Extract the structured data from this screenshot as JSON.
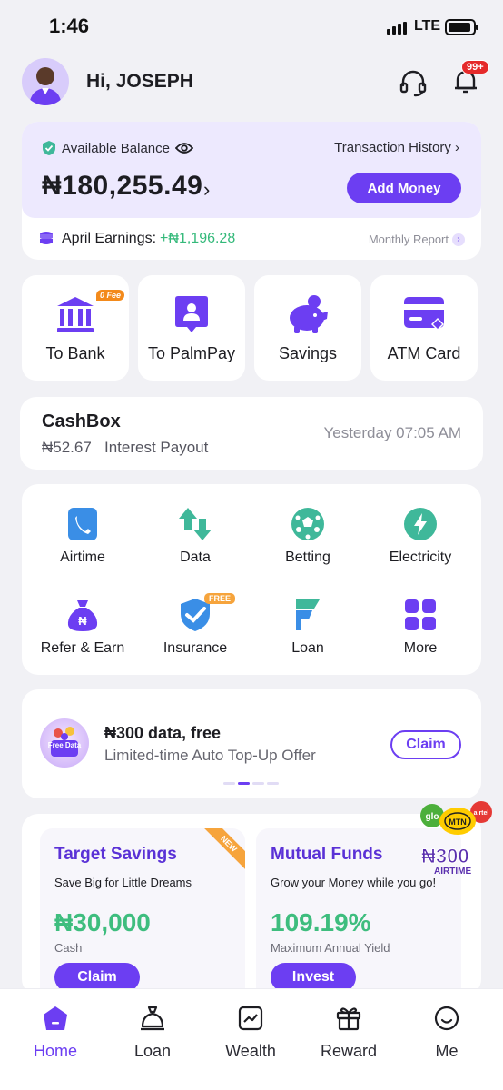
{
  "status": {
    "time": "1:46",
    "network": "LTE"
  },
  "header": {
    "greeting": "Hi, JOSEPH",
    "notif_badge": "99+"
  },
  "balance": {
    "label": "Available Balance",
    "history_link": "Transaction History",
    "amount": "₦180,255.49",
    "add_money": "Add Money",
    "earnings_label": "April Earnings:",
    "earnings_value": "+₦1,196.28",
    "monthly_report": "Monthly Report"
  },
  "quick_actions": [
    {
      "label": "To Bank",
      "icon": "bank-icon",
      "badge": "0 Fee"
    },
    {
      "label": "To PalmPay",
      "icon": "palmpay-icon"
    },
    {
      "label": "Savings",
      "icon": "piggy-bank-icon"
    },
    {
      "label": "ATM Card",
      "icon": "atm-card-icon"
    }
  ],
  "cashbox": {
    "title": "CashBox",
    "amount": "₦52.67",
    "desc": "Interest Payout",
    "time": "Yesterday 07:05 AM"
  },
  "services": [
    {
      "label": "Airtime",
      "icon": "phone-icon"
    },
    {
      "label": "Data",
      "icon": "data-arrows-icon"
    },
    {
      "label": "Betting",
      "icon": "soccer-ball-icon"
    },
    {
      "label": "Electricity",
      "icon": "lightning-icon"
    },
    {
      "label": "Refer & Earn",
      "icon": "money-bag-icon"
    },
    {
      "label": "Insurance",
      "icon": "shield-icon",
      "badge": "FREE"
    },
    {
      "label": "Loan",
      "icon": "loan-icon"
    },
    {
      "label": "More",
      "icon": "grid-icon"
    }
  ],
  "promo": {
    "title": "₦300 data, free",
    "subtitle": "Limited-time Auto Top-Up Offer",
    "claim": "Claim",
    "image_text": "Free Data"
  },
  "products": [
    {
      "title": "Target Savings",
      "subtitle": "Save Big for Little Dreams",
      "value": "₦30,000",
      "caption": "Cash",
      "button": "Claim",
      "ribbon": "NEW"
    },
    {
      "title": "Mutual Funds",
      "subtitle": "Grow your Money while you go!",
      "value": "109.19%",
      "caption": "Maximum Annual Yield",
      "button": "Invest"
    }
  ],
  "airtime_float": {
    "amount": "₦300",
    "label": "AIRTIME",
    "logos": [
      "glo",
      "MTN",
      "airtel"
    ]
  },
  "tabs": [
    {
      "label": "Home",
      "icon": "home-icon",
      "active": true
    },
    {
      "label": "Loan",
      "icon": "loan-bag-icon"
    },
    {
      "label": "Wealth",
      "icon": "chart-icon"
    },
    {
      "label": "Reward",
      "icon": "gift-icon"
    },
    {
      "label": "Me",
      "icon": "smiley-icon"
    }
  ],
  "colors": {
    "accent": "#6c3ef2",
    "green": "#34b97a",
    "teal": "#3fb89a",
    "blue": "#3a8ee6",
    "orange": "#f6a43c"
  }
}
